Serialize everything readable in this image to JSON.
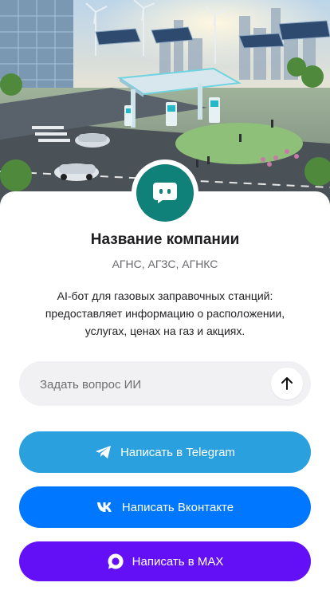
{
  "hero": {
    "image_alt": "",
    "icon": "gas-station-illustration"
  },
  "company": {
    "avatar_icon": "chat-bot-icon",
    "name": "Название компании",
    "tags": "АГНС, АГЗС, АГНКС",
    "description": "AI-бот для газовых заправочных станций: предоставляет информацию о расположении, услугах, ценах на газ и акциях."
  },
  "ask": {
    "placeholder": "Задать вопрос ИИ",
    "value": "",
    "send_icon": "arrow-up-icon"
  },
  "buttons": {
    "telegram": {
      "label": "Написать в Telegram",
      "icon": "telegram-icon",
      "color": "#2aa1de"
    },
    "vk": {
      "label": "Написать Вконтакте",
      "icon": "vk-icon",
      "color": "#0077ff"
    },
    "max": {
      "label": "Написать в MAX",
      "icon": "max-icon",
      "color": "#6410f6"
    }
  },
  "colors": {
    "accent": "#0f8178"
  }
}
